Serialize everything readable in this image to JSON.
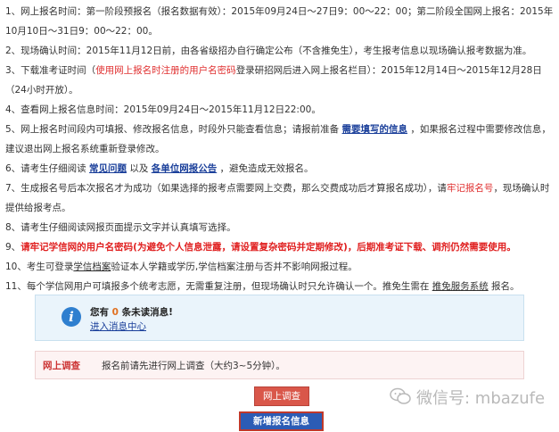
{
  "notes": [
    {
      "parts": [
        "1、网上报名时间：第一阶段预报名（报名数据有效）：2015年09月24日～27日9：00～22：00；第二阶段全国网上报名：2015年10月10日～31日9：00～22：00。"
      ]
    },
    {
      "parts": [
        "2、现场确认时间：2015年11月12日前，由各省级招办自行确定公布（不含推免生），考生报考信息以现场确认报考数据为准。"
      ]
    },
    {
      "a": "3、下载准考证时间（",
      "b": "使用网上报名时注册的用户名密码",
      "c": "登录研招网后进入网上报名栏目）：2015年12月14日～2015年12月28日（24小时开放）。"
    },
    {
      "parts": [
        "4、查看网上报名信息时间：2015年09月24日～2015年11月12日22:00。"
      ]
    },
    {
      "a": "5、网上报名时间段内可填报、修改报名信息，时段外只能查看信息；请报前准备 ",
      "link": "需要填写的信息",
      "c": " ，如果报名过程中需要修改信息，建议退出网上报名系统重新登录修改。"
    },
    {
      "a": "6、请考生仔细阅读 ",
      "link1": "常见问题",
      "mid": " 以及 ",
      "link2": "各单位网报公告",
      "c": " ，避免造成无效报名。"
    },
    {
      "a": "7、生成报名号后本次报名才为成功（如果选择的报考点需要网上交费，那么交费成功后才算报名成功），请",
      "b": "牢记报名号",
      "c": "，现场确认时提供给报考点。"
    },
    {
      "parts": [
        "8、请考生仔细阅读网报页面提示文字并认真填写选择。"
      ]
    },
    {
      "a": "9、",
      "b": "请牢记学信网的用户名密码(为避免个人信息泄露，请设置复杂密码并定期修改)，后期准考证下载、调剂仍然需要使用。"
    },
    {
      "a": "10、考生可登录",
      "link": "学信档案",
      "c": "验证本人学籍或学历,学信档案注册与否并不影响网报过程。"
    },
    {
      "a": "11、每个学信网用户可填报多个统考志愿，无需重复注册，但现场确认时只允许确认一个。推免生需在 ",
      "link": "推免服务系统",
      "c": " 报名。"
    }
  ],
  "messages": {
    "pre": "您有 ",
    "count": "0",
    "post": " 条未读消息!",
    "link": "进入消息中心",
    "icon": "info-icon"
  },
  "survey": {
    "label": "网上调查",
    "text": "报名前请先进行网上调查（大约3~5分钟）。",
    "button": "网上调查"
  },
  "add_button": "新增报名信息",
  "watermark": "微信号: mbazufe",
  "colors": {
    "accent_red": "#e03030",
    "link_blue": "#1a3f9a",
    "button_red": "#d9574a",
    "button_blue": "#2c5cb5"
  }
}
